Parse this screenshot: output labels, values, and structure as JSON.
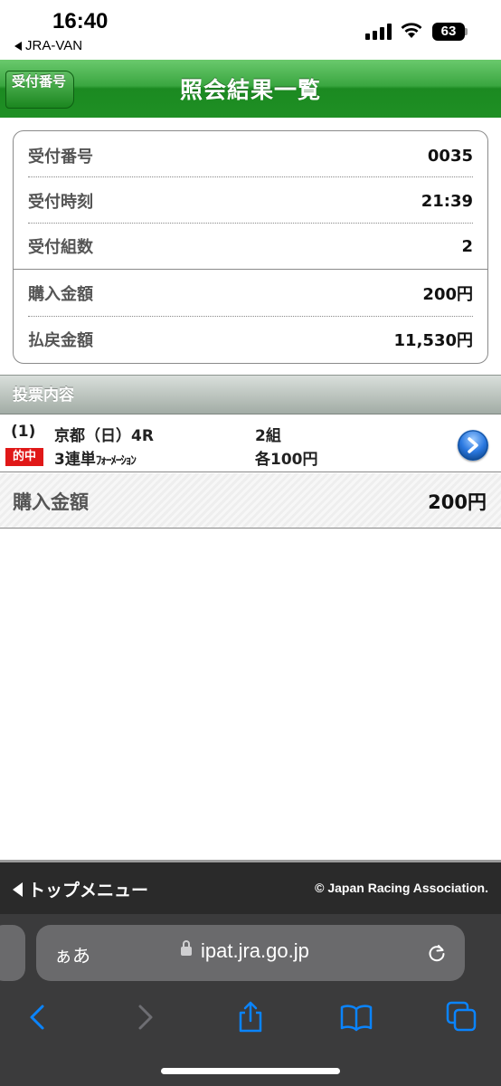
{
  "status_bar": {
    "time": "16:40",
    "back_app": "JRA-VAN",
    "battery": "63"
  },
  "header": {
    "back_label": "受付番号",
    "title": "照会結果一覧",
    "accent_color": "#1f8f24"
  },
  "summary": {
    "rows": [
      {
        "label": "受付番号",
        "value": "0035"
      },
      {
        "label": "受付時刻",
        "value": "21:39"
      },
      {
        "label": "受付組数",
        "value": "2"
      },
      {
        "label": "購入金額",
        "value": "200円"
      },
      {
        "label": "払戻金額",
        "value": "11,530円"
      }
    ]
  },
  "bets": {
    "section_title": "投票内容",
    "items": [
      {
        "number": "(1)",
        "race": "京都（日）4R",
        "groups": "2組",
        "hit_badge": "的中",
        "type_prefix": "3連単",
        "type_suffix": "ﾌｫｰﾒｰｼｮﾝ",
        "amount_each": "各100円"
      }
    ],
    "total_label": "購入金額",
    "total_value": "200円",
    "hit_color": "#e01818"
  },
  "footer": {
    "menu_label": "トップメニュー",
    "copyright": "© Japan Racing Association."
  },
  "browser": {
    "aa_label": "ぁあ",
    "url": "ipat.jra.go.jp",
    "icons": [
      "back-icon",
      "forward-icon",
      "share-icon",
      "bookmarks-icon",
      "tabs-icon"
    ],
    "accent_color": "#0a84ff"
  }
}
